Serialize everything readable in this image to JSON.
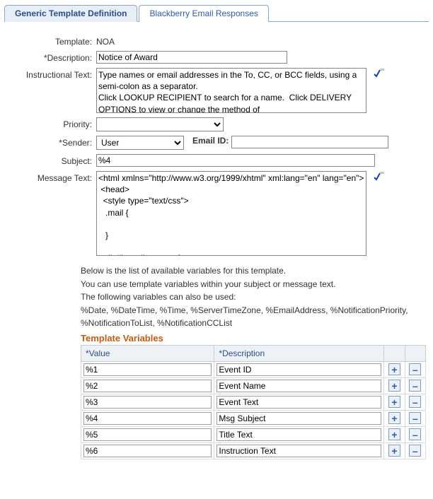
{
  "tabs": {
    "active": "Generic Template Definition",
    "inactive": "Blackberry Email Responses"
  },
  "labels": {
    "template": "Template:",
    "description": "*Description:",
    "instructional": "Instructional Text:",
    "priority": "Priority:",
    "sender": "*Sender:",
    "emailid": "Email ID:",
    "subject": "Subject:",
    "message": "Message Text:"
  },
  "values": {
    "template": "NOA",
    "description": "Notice of Award",
    "instructional": "Type names or email addresses in the To, CC, or BCC fields, using a semi-colon as a separator.\nClick LOOKUP RECIPIENT to search for a name.  Click DELIVERY OPTIONS to view or change the method of",
    "priority": "",
    "sender": "User",
    "emailid": "",
    "subject": "%4",
    "message": "<html xmlns=\"http://www.w3.org/1999/xhtml\" xml:lang=\"en\" lang=\"en\">\n <head>\n  <style type=\"text/css\">\n   .mail {\n\n   }\n\n   div#branding span {\n    display: none;"
  },
  "helptext": {
    "l1": "Below is the list of available variables for this template.",
    "l2": "You can use template variables within your subject or message text.",
    "l3": "The following variables can also be used:",
    "l4": "%Date, %DateTime, %Time, %ServerTimeZone, %EmailAddress, %NotificationPriority, %NotificationToList, %NotificationCCList"
  },
  "tv": {
    "title": "Template Variables",
    "col1": "*Value",
    "col2": "*Description",
    "rows": [
      {
        "value": "%1",
        "desc": "Event ID"
      },
      {
        "value": "%2",
        "desc": "Event Name"
      },
      {
        "value": "%3",
        "desc": "Event Text"
      },
      {
        "value": "%4",
        "desc": "Msg Subject"
      },
      {
        "value": "%5",
        "desc": "Title Text"
      },
      {
        "value": "%6",
        "desc": "Instruction Text"
      }
    ],
    "add": "+",
    "del": "–"
  }
}
